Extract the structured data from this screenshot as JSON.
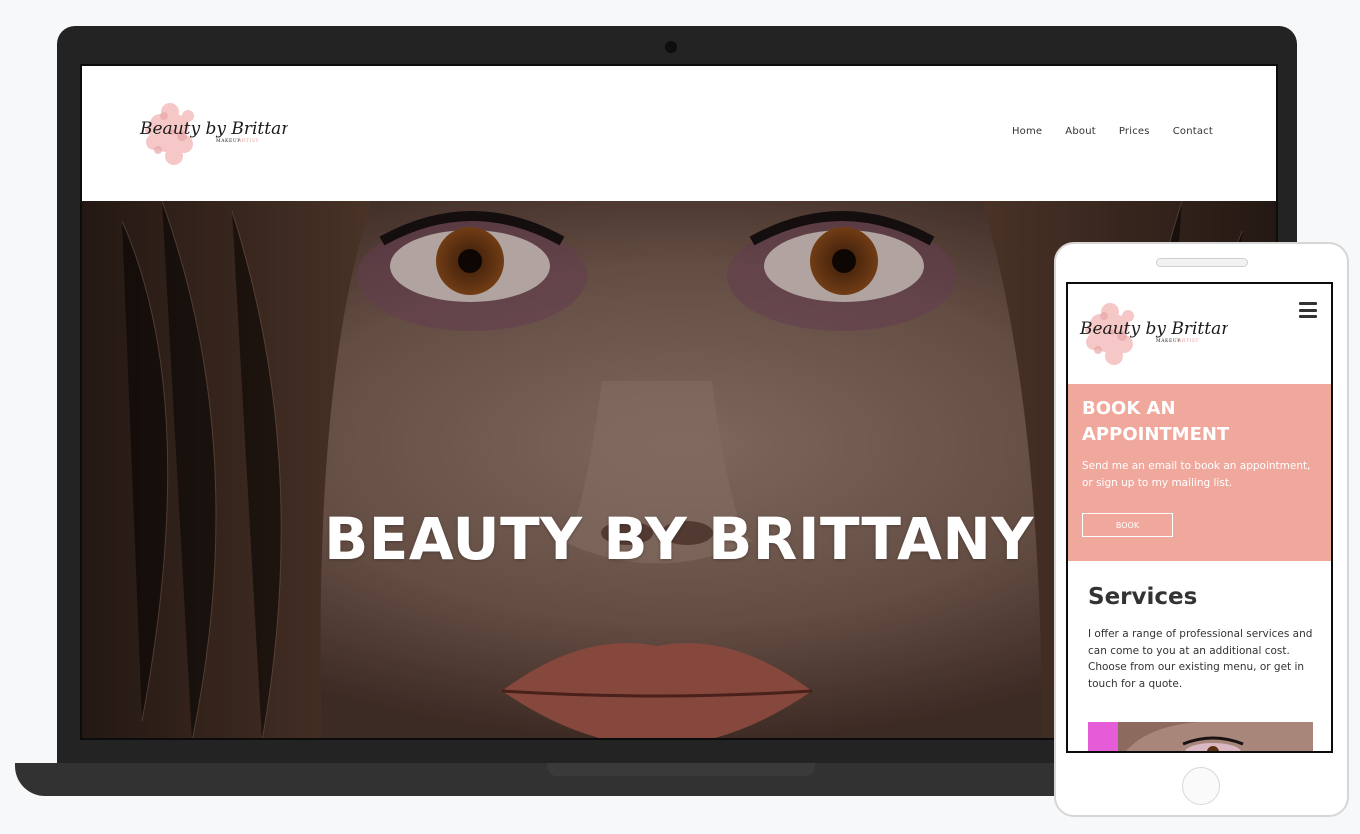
{
  "desktop": {
    "logo": {
      "script": "Beauty by Brittany",
      "subtitle_a": "MAKEUP",
      "subtitle_b": "ARTIST"
    },
    "nav": [
      {
        "label": "Home"
      },
      {
        "label": "About"
      },
      {
        "label": "Prices"
      },
      {
        "label": "Contact"
      }
    ],
    "hero": {
      "title": "BEAUTY BY BRITTANY"
    }
  },
  "mobile": {
    "logo": {
      "script": "Beauty by Brittany",
      "subtitle_a": "MAKEUP",
      "subtitle_b": "ARTIST"
    },
    "book": {
      "title": "BOOK AN APPOINTMENT",
      "text": "Send me an email to book an appointment, or sign up to my mailing list.",
      "button": "BOOK"
    },
    "services": {
      "title": "Services",
      "text": "I offer a range of professional services and can come to you at an additional cost. Choose from our existing menu, or get in touch for a quote."
    }
  },
  "colors": {
    "accent": "#f0a89d",
    "laptop_frame": "#232323",
    "text": "#333333"
  },
  "icons": [
    "hamburger-menu-icon"
  ]
}
